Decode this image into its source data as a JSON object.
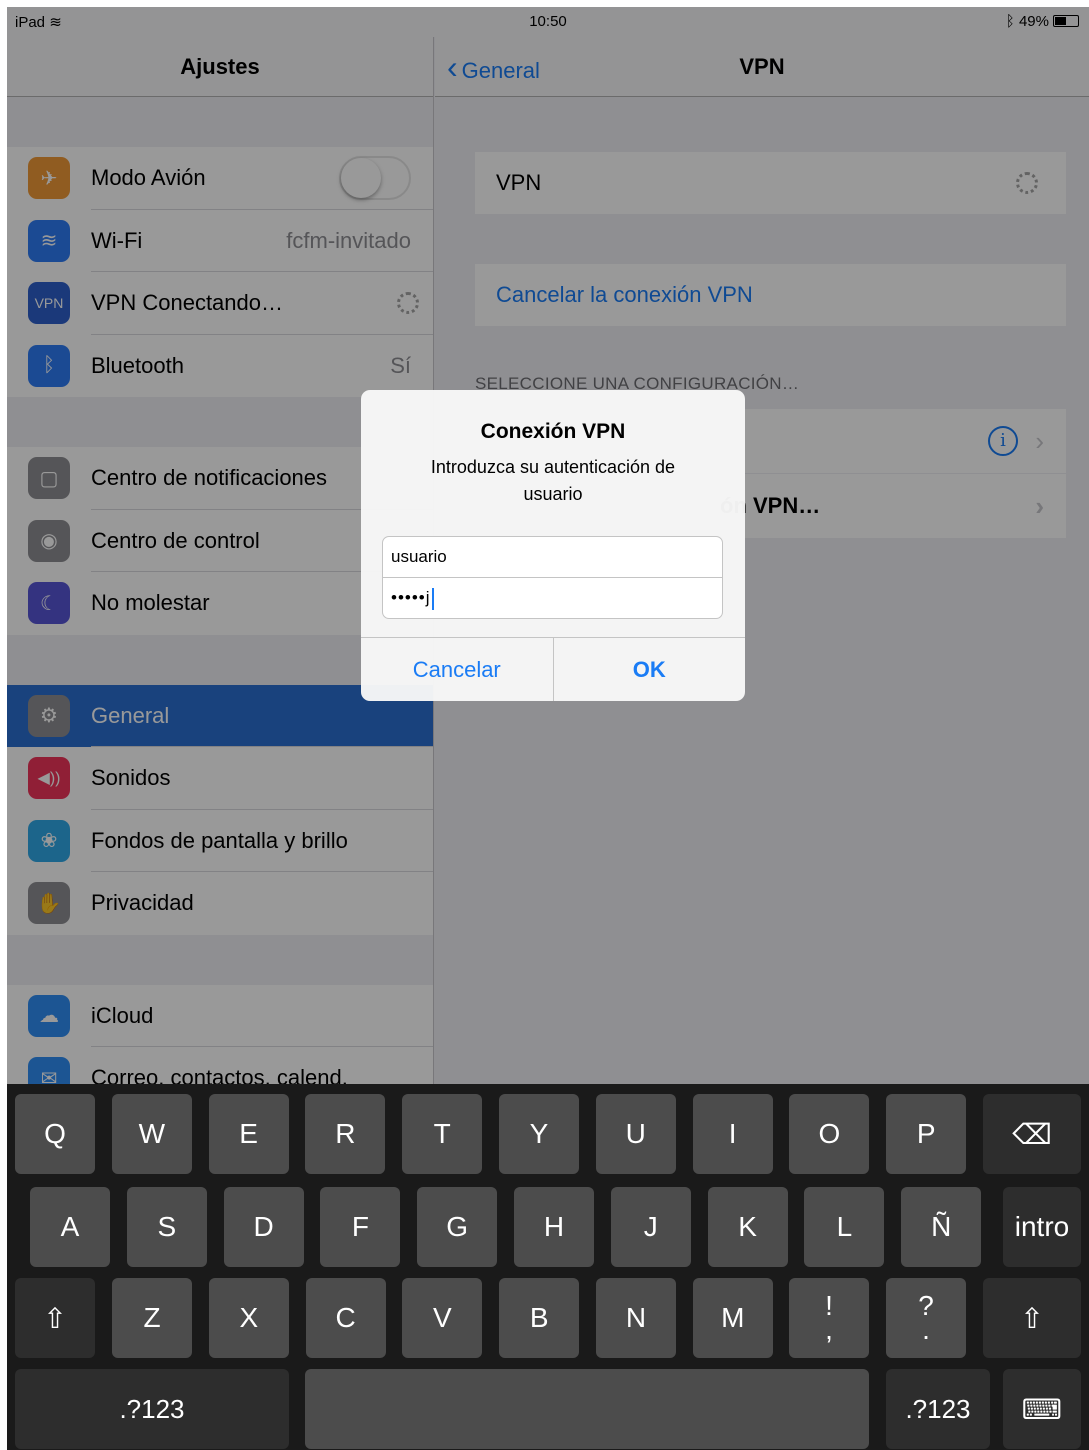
{
  "status": {
    "device": "iPad",
    "time": "10:50",
    "battery": "49%"
  },
  "left": {
    "title": "Ajustes",
    "group1": [
      {
        "label": "Modo Avión",
        "icon": "airplane-icon",
        "color": "#f19a37"
      },
      {
        "label": "Wi-Fi",
        "value": "fcfm-invitado",
        "icon": "wifi-icon",
        "color": "#2e7cf6"
      },
      {
        "label": "VPN Conectando…",
        "icon": "vpn-icon",
        "icon_text": "VPN",
        "color": "#2e5fcc"
      },
      {
        "label": "Bluetooth",
        "value": "Sí",
        "icon": "bluetooth-icon",
        "color": "#2e7cf6"
      }
    ],
    "group2": [
      {
        "label": "Centro de notificaciones",
        "icon": "notifications-icon",
        "color": "#8e8e93"
      },
      {
        "label": "Centro de control",
        "icon": "control-center-icon",
        "color": "#8e8e93"
      },
      {
        "label": "No molestar",
        "icon": "moon-icon",
        "color": "#5856d6"
      }
    ],
    "group3": [
      {
        "label": "General",
        "icon": "gear-icon",
        "color": "#8e8e93"
      },
      {
        "label": "Sonidos",
        "icon": "speaker-icon",
        "color": "#f0345a"
      },
      {
        "label": "Fondos de pantalla y brillo",
        "icon": "flower-icon",
        "color": "#2fa8e8"
      },
      {
        "label": "Privacidad",
        "icon": "hand-icon",
        "color": "#8e8e93"
      }
    ],
    "group4": [
      {
        "label": "iCloud",
        "icon": "cloud-icon",
        "color": "#2f8ef5"
      },
      {
        "label": "Correo, contactos, calend.",
        "icon": "mail-icon",
        "color": "#2f8ef5"
      }
    ]
  },
  "right": {
    "back": "General",
    "title": "VPN",
    "vpn_label": "VPN",
    "cancel_link": "Cancelar la conexión VPN",
    "section_header": "SELECCIONE UNA CONFIGURACIÓN…",
    "add_partial": "ón VPN…"
  },
  "alert": {
    "title": "Conexión VPN",
    "message": "Introduzca su autenticación de usuario",
    "username": "usuario",
    "password_mask": "•••••j",
    "cancel": "Cancelar",
    "ok": "OK"
  },
  "keyboard": {
    "row1": [
      "Q",
      "W",
      "E",
      "R",
      "T",
      "Y",
      "U",
      "I",
      "O",
      "P"
    ],
    "row2": [
      "A",
      "S",
      "D",
      "F",
      "G",
      "H",
      "J",
      "K",
      "L",
      "Ñ"
    ],
    "row3": [
      "Z",
      "X",
      "C",
      "V",
      "B",
      "N",
      "M"
    ],
    "excl": [
      "!",
      ","
    ],
    "quest": [
      "?",
      "."
    ],
    "intro": "intro",
    "numbers": ".?123"
  }
}
